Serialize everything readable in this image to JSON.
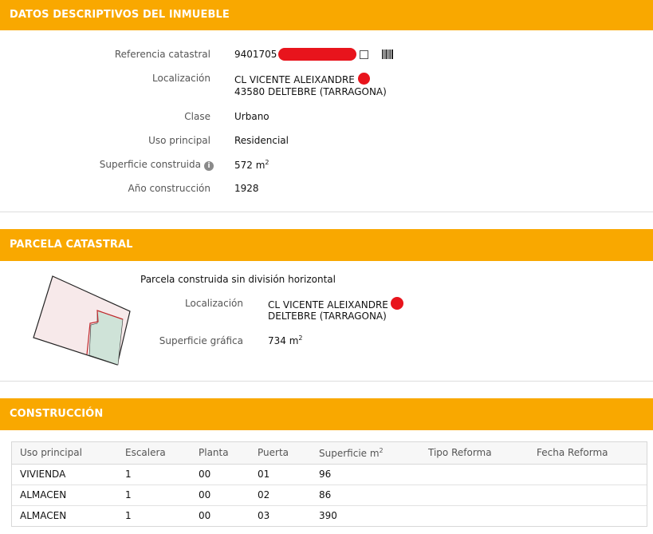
{
  "inmueble": {
    "header": "DATOS DESCRIPTIVOS DEL INMUEBLE",
    "fields": [
      {
        "label": "Referencia catastral",
        "value": "9401705"
      },
      {
        "label": "Localización",
        "value": "CL VICENTE ALEIXANDRE",
        "value2": "43580 DELTEBRE (TARRAGONA)"
      },
      {
        "label": "Clase",
        "value": "Urbano"
      },
      {
        "label": "Uso principal",
        "value": "Residencial"
      },
      {
        "label": "Superficie construida",
        "value": "572 m",
        "sup": "2"
      },
      {
        "label": "Año construcción",
        "value": "1928"
      }
    ]
  },
  "parcela": {
    "header": "PARCELA CATASTRAL",
    "title": "Parcela construida sin división horizontal",
    "loc_label": "Localización",
    "loc_value": "CL VICENTE ALEIXANDRE",
    "loc_value2": "DELTEBRE (TARRAGONA)",
    "sup_label": "Superficie gráfica",
    "sup_value": "734 m",
    "sup_sup": "2"
  },
  "construccion": {
    "header": "CONSTRUCCIÓN",
    "columns": [
      "Uso principal",
      "Escalera",
      "Planta",
      "Puerta",
      "Superficie m",
      "Tipo Reforma",
      "Fecha Reforma"
    ],
    "sup_col_sup": "2",
    "rows": [
      [
        "VIVIENDA",
        "1",
        "00",
        "01",
        "96",
        "",
        ""
      ],
      [
        "ALMACEN",
        "1",
        "00",
        "02",
        "86",
        "",
        ""
      ],
      [
        "ALMACEN",
        "1",
        "00",
        "03",
        "390",
        "",
        ""
      ]
    ]
  },
  "icons": {
    "copy": "copy-icon",
    "barcode": "barcode-icon",
    "info": "info-icon"
  },
  "colors": {
    "header_bg": "#f9a800",
    "redaction": "#e8141c",
    "parcel_fill": "#f7e9ea",
    "building_fill": "#cfe3d8"
  }
}
